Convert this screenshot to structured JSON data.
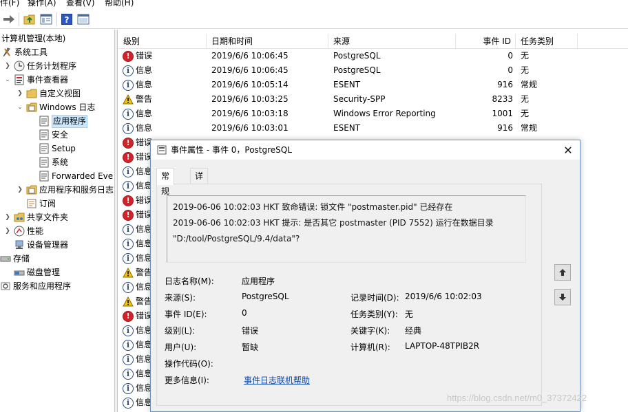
{
  "menubar": {
    "items": [
      "件(F)",
      "操作(A)",
      "查看(V)",
      "帮助(H)"
    ]
  },
  "tree": {
    "items": [
      {
        "label": "计算机管理(本地)",
        "icon": "computer-management-icon"
      },
      {
        "label": "系统工具",
        "icon": "tools-icon"
      },
      {
        "label": "任务计划程序",
        "icon": "clock-icon"
      },
      {
        "label": "事件查看器",
        "icon": "event-viewer-icon"
      },
      {
        "label": "自定义视图",
        "icon": "folder-icon"
      },
      {
        "label": "Windows 日志",
        "icon": "folder-icon"
      },
      {
        "label": "应用程序",
        "icon": "log-icon"
      },
      {
        "label": "安全",
        "icon": "log-icon"
      },
      {
        "label": "Setup",
        "icon": "log-icon"
      },
      {
        "label": "系统",
        "icon": "log-icon"
      },
      {
        "label": "Forwarded Eve",
        "icon": "log-icon"
      },
      {
        "label": "应用程序和服务日志",
        "icon": "folder-icon"
      },
      {
        "label": "订阅",
        "icon": "subscription-icon"
      },
      {
        "label": "共享文件夹",
        "icon": "shared-folder-icon"
      },
      {
        "label": "性能",
        "icon": "performance-icon"
      },
      {
        "label": "设备管理器",
        "icon": "device-manager-icon"
      },
      {
        "label": "存储",
        "icon": "storage-icon"
      },
      {
        "label": "磁盘管理",
        "icon": "disk-icon"
      },
      {
        "label": "服务和应用程序",
        "icon": "services-icon"
      }
    ]
  },
  "list": {
    "headers": {
      "level": "级别",
      "datetime": "日期和时间",
      "source": "来源",
      "event_id": "事件 ID",
      "category": "任务类别"
    },
    "rows": [
      {
        "level": "错误",
        "type": "error",
        "datetime": "2019/6/6 10:06:45",
        "source": "PostgreSQL",
        "event_id": "0",
        "category": "无"
      },
      {
        "level": "信息",
        "type": "info",
        "datetime": "2019/6/6 10:06:45",
        "source": "PostgreSQL",
        "event_id": "0",
        "category": "无"
      },
      {
        "level": "信息",
        "type": "info",
        "datetime": "2019/6/6 10:05:14",
        "source": "ESENT",
        "event_id": "916",
        "category": "常规"
      },
      {
        "level": "警告",
        "type": "warn",
        "datetime": "2019/6/6 10:03:25",
        "source": "Security-SPP",
        "event_id": "8233",
        "category": "无"
      },
      {
        "level": "信息",
        "type": "info",
        "datetime": "2019/6/6 10:03:18",
        "source": "Windows Error Reporting",
        "event_id": "1001",
        "category": "无"
      },
      {
        "level": "信息",
        "type": "info",
        "datetime": "2019/6/6 10:03:01",
        "source": "ESENT",
        "event_id": "916",
        "category": "常规"
      },
      {
        "level": "错误",
        "type": "error"
      },
      {
        "level": "错误",
        "type": "error"
      },
      {
        "level": "信息",
        "type": "info"
      },
      {
        "level": "信息",
        "type": "info"
      },
      {
        "level": "错误",
        "type": "error"
      },
      {
        "level": "错误",
        "type": "error"
      },
      {
        "level": "信息",
        "type": "info"
      },
      {
        "level": "信息",
        "type": "info"
      },
      {
        "level": "信息",
        "type": "info"
      },
      {
        "level": "警告",
        "type": "warn"
      },
      {
        "level": "信息",
        "type": "info"
      },
      {
        "level": "警告",
        "type": "warn"
      },
      {
        "level": "错误",
        "type": "error"
      },
      {
        "level": "信息",
        "type": "info"
      },
      {
        "level": "信息",
        "type": "info"
      },
      {
        "level": "信息",
        "type": "info"
      },
      {
        "level": "信息",
        "type": "info"
      },
      {
        "level": "信息",
        "type": "info"
      },
      {
        "level": "信息",
        "type": "info"
      },
      {
        "level": "信息",
        "type": "info"
      }
    ]
  },
  "dialog": {
    "title": "事件属性 - 事件 0，PostgreSQL",
    "tabs": [
      "常规",
      "详细信息"
    ],
    "description": [
      "2019-06-06 10:02:03 HKT 致命错误:  锁文件 \"postmaster.pid\" 已经存在",
      "2019-06-06 10:02:03 HKT 提示:  是否其它 postmaster (PID 7552) 运行在数据目录",
      "\"D:/tool/PostgreSQL/9.4/data\"?"
    ],
    "fields": {
      "log_name_label": "日志名称(M):",
      "log_name": "应用程序",
      "source_label": "来源(S):",
      "source": "PostgreSQL",
      "recorded_label": "记录时间(D):",
      "recorded": "2019/6/6 10:02:03",
      "event_id_label": "事件 ID(E):",
      "event_id": "0",
      "task_category_label": "任务类别(Y):",
      "task_category": "无",
      "level_label": "级别(L):",
      "level": "错误",
      "keywords_label": "关键字(K):",
      "keywords": "经典",
      "user_label": "用户(U):",
      "user": "暂缺",
      "computer_label": "计算机(R):",
      "computer": "LAPTOP-48TPIB2R",
      "opcode_label": "操作代码(O):",
      "opcode": "",
      "more_info_label": "更多信息(I):",
      "more_info_link": "事件日志联机帮助"
    }
  },
  "watermark": "https://blog.csdn.net/m0_37372422"
}
